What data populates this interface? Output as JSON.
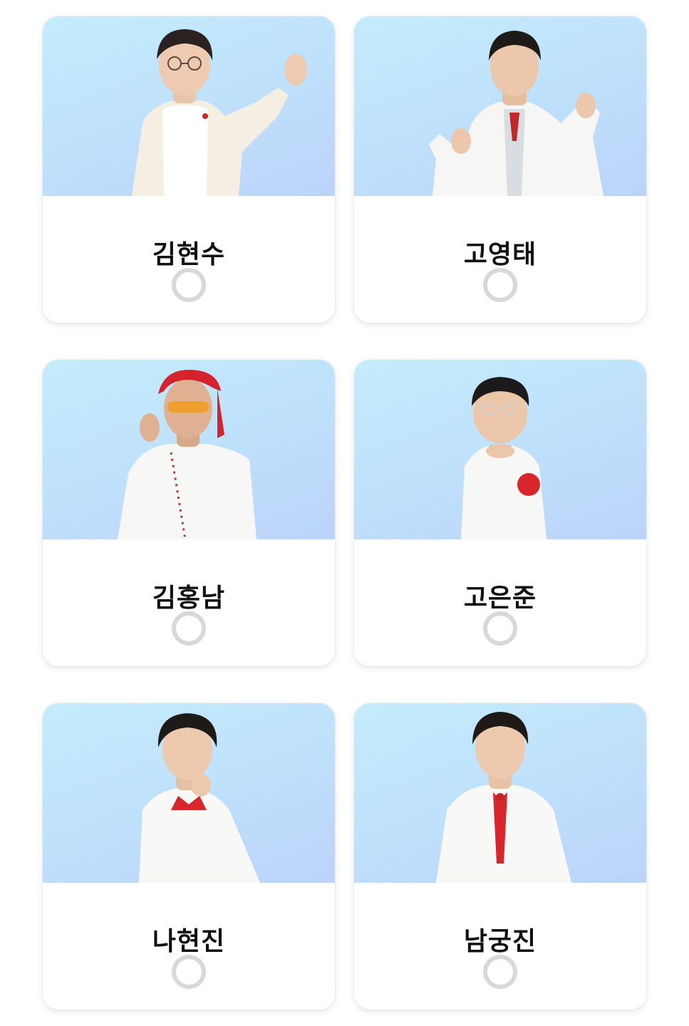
{
  "candidates": [
    {
      "name": "김현수",
      "photo": "person-portrait-white-suit-glasses",
      "selected": false
    },
    {
      "name": "고영태",
      "photo": "person-portrait-white-suit-thumbs",
      "selected": false
    },
    {
      "name": "김홍남",
      "photo": "person-portrait-red-bandana-sunglasses",
      "selected": false
    },
    {
      "name": "고은준",
      "photo": "person-portrait-child-glasses-red-flower",
      "selected": false
    },
    {
      "name": "나현진",
      "photo": "person-portrait-white-suit-red-bow",
      "selected": false
    },
    {
      "name": "남궁진",
      "photo": "person-portrait-white-suit-red-tie",
      "selected": false
    }
  ],
  "colors": {
    "photo_bg_top": "#c4ecfb",
    "photo_bg_bottom": "#bcd3fa",
    "radio_ring": "#d6d8dc",
    "accent_red": "#d9262c"
  }
}
